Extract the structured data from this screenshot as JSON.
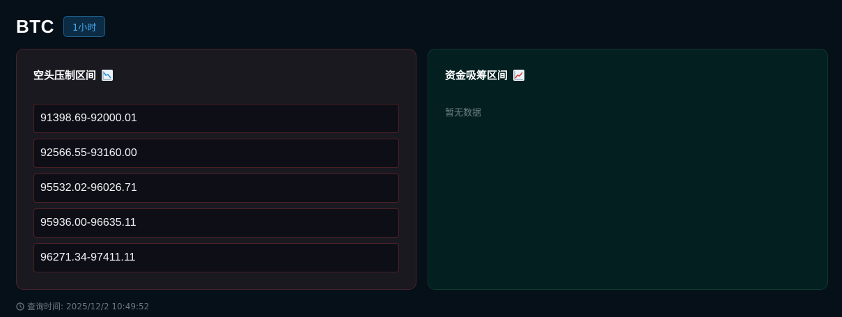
{
  "header": {
    "symbol": "BTC",
    "timeframe": "1小时"
  },
  "short_panel": {
    "title": "空头压制区间",
    "icon": "chart-decreasing-icon",
    "zones": [
      "91398.69-92000.01",
      "92566.55-93160.00",
      "95532.02-96026.71",
      "95936.00-96635.11",
      "96271.34-97411.11"
    ]
  },
  "accumulation_panel": {
    "title": "资金吸筹区间",
    "icon": "chart-increasing-icon",
    "empty_text": "暂无数据"
  },
  "footer": {
    "icon": "clock-icon",
    "label": "查询时间:",
    "timestamp": "2025/12/2 10:49:52"
  },
  "colors": {
    "background": "#061019",
    "short_border": "#47232c",
    "accumulation_bg": "#031f20",
    "badge_text": "#4aa8f0"
  }
}
